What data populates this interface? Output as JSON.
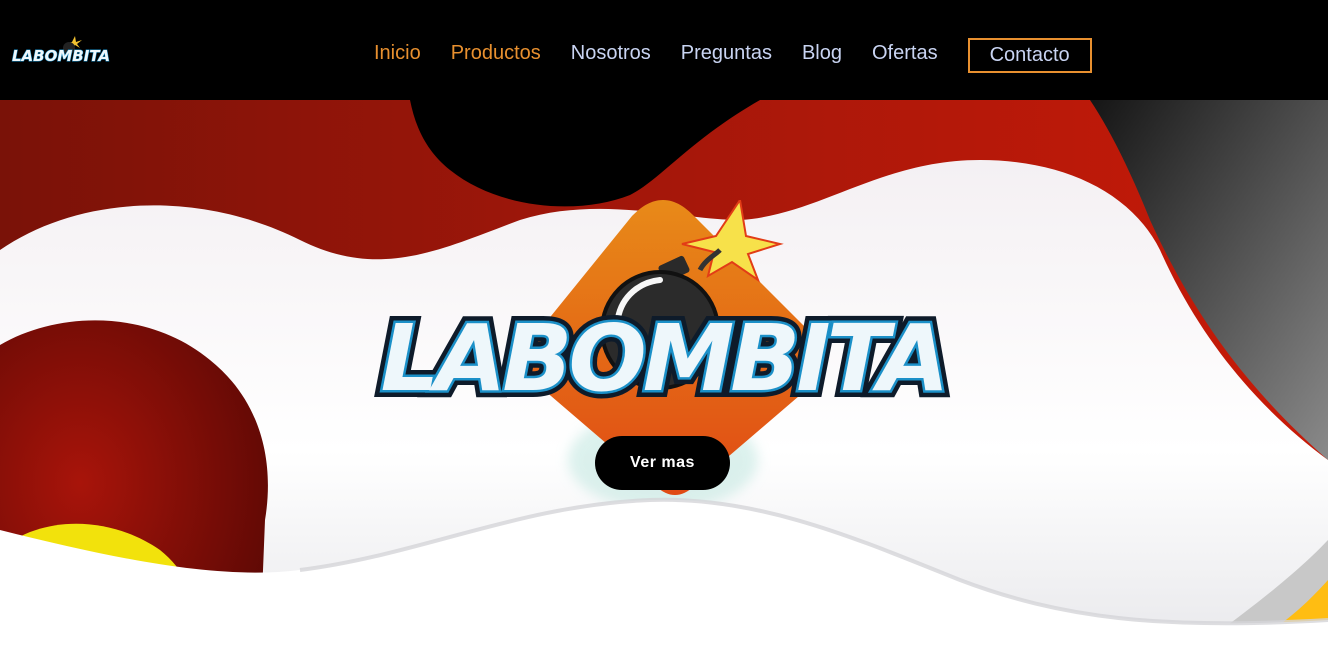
{
  "header": {
    "logo_text": "LABOMBITA",
    "nav": [
      {
        "label": "Inicio",
        "active": true
      },
      {
        "label": "Productos",
        "active": true
      },
      {
        "label": "Nosotros",
        "active": false
      },
      {
        "label": "Preguntas",
        "active": false
      },
      {
        "label": "Blog",
        "active": false
      },
      {
        "label": "Ofertas",
        "active": false
      }
    ],
    "contact_label": "Contacto"
  },
  "hero": {
    "logo_text": "LABOMBITA",
    "cta_label": "Ver mas"
  },
  "colors": {
    "nav_bg": "#000000",
    "nav_link": "#c9d4f2",
    "accent_orange": "#e8902f",
    "hero_red": "#c0170a",
    "hero_yellow": "#f2e20c",
    "logo_fill": "#eef7fb",
    "logo_outline": "#1b90c8"
  }
}
